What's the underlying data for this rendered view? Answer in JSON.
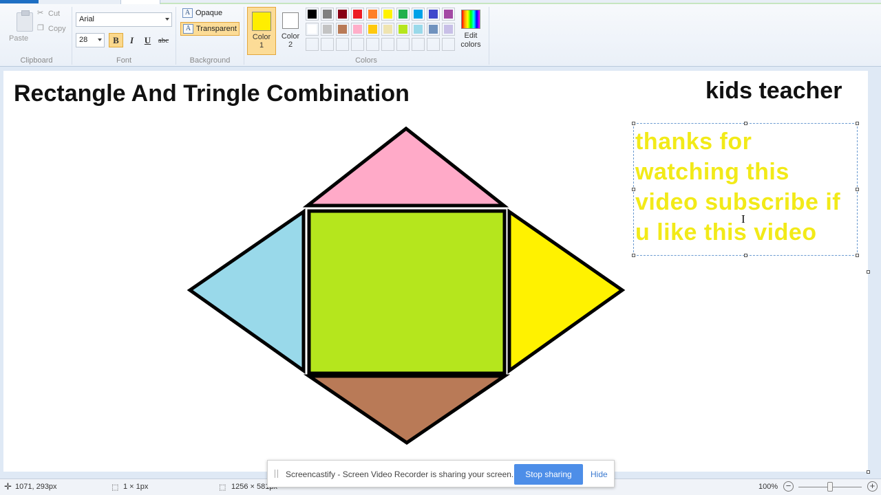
{
  "ribbon": {
    "clipboard": {
      "paste": "Paste",
      "cut": "Cut",
      "copy": "Copy",
      "label": "Clipboard"
    },
    "font": {
      "family": "Arial",
      "size": "28",
      "bold": "B",
      "italic": "I",
      "underline": "U",
      "strikethrough": "abc",
      "label": "Font"
    },
    "background": {
      "opaque": "Opaque",
      "transparent": "Transparent",
      "label": "Background"
    },
    "colors": {
      "color1_label": "Color\n1",
      "color2_label": "Color\n2",
      "color1": "#ffee00",
      "color2": "#ffffff",
      "palette_row1": [
        "#000000",
        "#7f7f7f",
        "#880015",
        "#ed1c24",
        "#ff7f27",
        "#fff200",
        "#22b14c",
        "#00a2e8",
        "#3f48cc",
        "#a349a4"
      ],
      "palette_row2": [
        "#ffffff",
        "#c3c3c3",
        "#b97a57",
        "#ffaec9",
        "#ffc90e",
        "#efe4b0",
        "#b5e61d",
        "#99d9ea",
        "#7092be",
        "#c8bfe7"
      ],
      "edit_colors": "Edit colors",
      "label": "Colors"
    }
  },
  "canvas": {
    "title": "Rectangle And Tringle Combination",
    "author": "kids teacher",
    "textbox_text": "thanks for watching this video subscribe if u like this video",
    "shape_colors": {
      "top_triangle": "#ffaac8",
      "left_triangle": "#99d9ea",
      "rectangle": "#b5e61d",
      "right_triangle": "#fff200",
      "bottom_triangle": "#b97a57"
    }
  },
  "statusbar": {
    "cursor_pos": "1071, 293px",
    "selection_size": "1 × 1px",
    "canvas_size": "1256 × 581px",
    "zoom": "100%"
  },
  "banner": {
    "message": "Screencastify - Screen Video Recorder is sharing your screen.",
    "stop_button": "Stop sharing",
    "hide_link": "Hide"
  }
}
